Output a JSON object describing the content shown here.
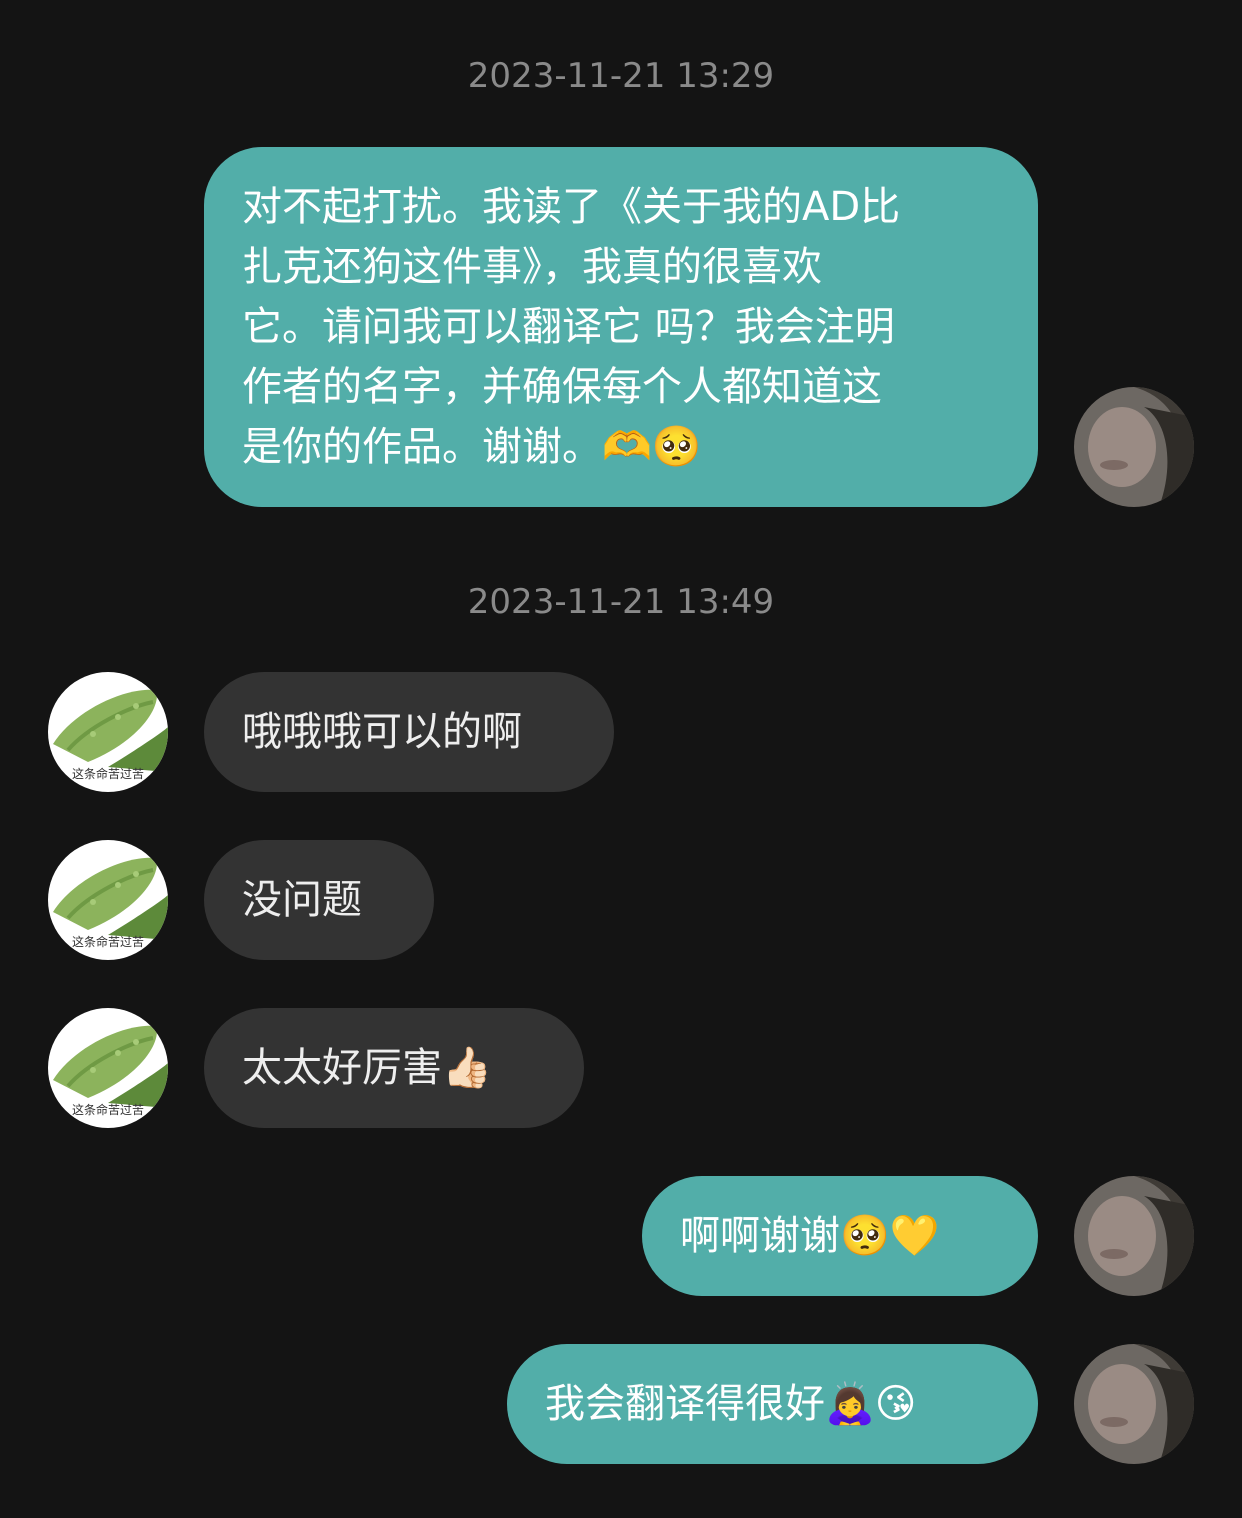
{
  "chat": {
    "timestamps": [
      "2023-11-21 13:29",
      "2023-11-21 13:49"
    ],
    "messages": [
      {
        "sender": "me",
        "lines": [
          "对不起打扰。我读了《关于我的AD比",
          "扎克还狗这件事》，我真的很喜欢",
          "它。请问我可以翻译它 吗？我会注明",
          "作者的名字，并确保每个人都知道这",
          "是你的作品。谢谢。🫶🥺"
        ]
      },
      {
        "sender": "other",
        "text": "哦哦哦可以的啊"
      },
      {
        "sender": "other",
        "text": "没问题"
      },
      {
        "sender": "other",
        "text": "太太好厉害👍🏻"
      },
      {
        "sender": "me",
        "text": "啊啊谢谢🥺💛"
      },
      {
        "sender": "me",
        "text": "我会翻译得很好🙇‍♀️😘"
      }
    ]
  },
  "avatars": {
    "other_caption": "这条命苦过苦",
    "colors": {
      "my_bubble": "#52aea9",
      "their_bubble": "#333333",
      "background": "#141414"
    }
  }
}
